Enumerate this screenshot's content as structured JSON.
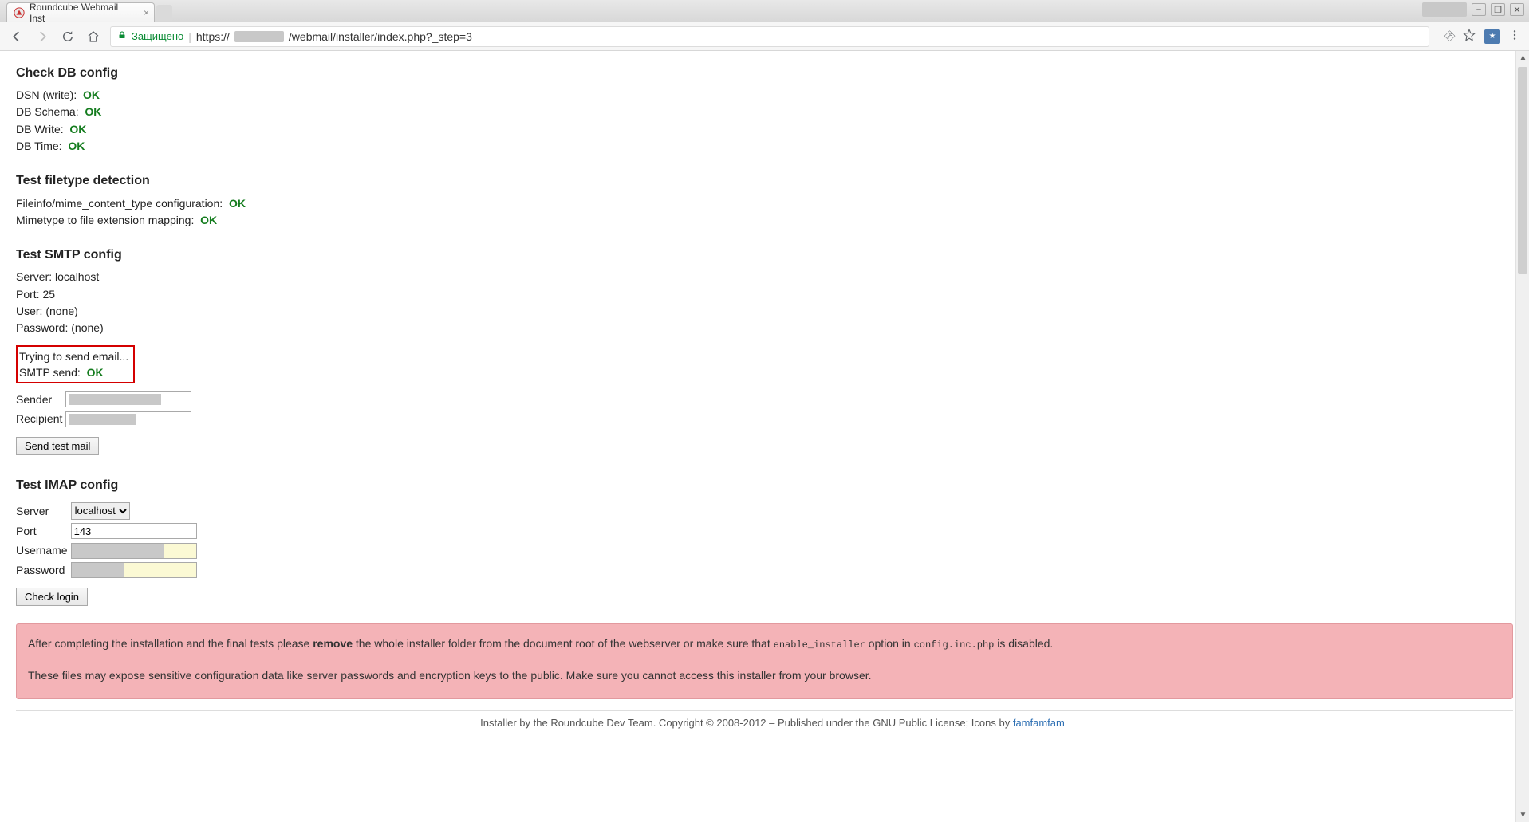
{
  "browser": {
    "tab_title": "Roundcube Webmail Inst",
    "secure_label": "Защищено",
    "url_prefix": "https://",
    "url_suffix": "/webmail/installer/index.php?_step=3"
  },
  "sections": {
    "db": {
      "heading": "Check DB config",
      "items": [
        {
          "label": "DSN (write):",
          "status": "OK"
        },
        {
          "label": "DB Schema:",
          "status": "OK"
        },
        {
          "label": "DB Write:",
          "status": "OK"
        },
        {
          "label": "DB Time:",
          "status": "OK"
        }
      ]
    },
    "filetype": {
      "heading": "Test filetype detection",
      "items": [
        {
          "label": "Fileinfo/mime_content_type configuration:",
          "status": "OK"
        },
        {
          "label": "Mimetype to file extension mapping:",
          "status": "OK"
        }
      ]
    },
    "smtp": {
      "heading": "Test SMTP config",
      "server_label": "Server:",
      "server_value": "localhost",
      "port_label": "Port:",
      "port_value": "25",
      "user_label": "User:",
      "user_value": "(none)",
      "password_label": "Password:",
      "password_value": "(none)",
      "attempt_text": "Trying to send email...",
      "send_label": "SMTP send:",
      "send_status": "OK",
      "sender_label": "Sender",
      "recipient_label": "Recipient",
      "button": "Send test mail"
    },
    "imap": {
      "heading": "Test IMAP config",
      "server_label": "Server",
      "server_option": "localhost",
      "port_label": "Port",
      "port_value": "143",
      "username_label": "Username",
      "password_label": "Password",
      "button": "Check login"
    }
  },
  "warning": {
    "part1": "After completing the installation and the final tests please ",
    "remove": "remove",
    "part2": " the whole installer folder from the document root of the webserver or make sure that ",
    "code1": "enable_installer",
    "part3": " option in ",
    "code2": "config.inc.php",
    "part4": " is disabled.",
    "line2": "These files may expose sensitive configuration data like server passwords and encryption keys to the public. Make sure you cannot access this installer from your browser."
  },
  "footer": {
    "text": "Installer by the Roundcube Dev Team. Copyright © 2008-2012 – Published under the GNU Public License;  Icons by ",
    "link": "famfamfam"
  }
}
